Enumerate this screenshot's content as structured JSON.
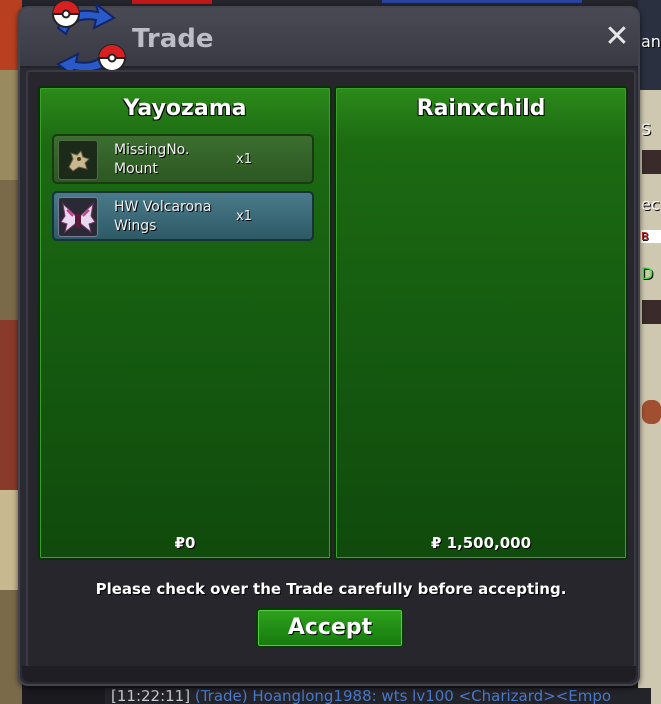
{
  "window": {
    "title": "Trade",
    "close_glyph": "✕"
  },
  "left_panel": {
    "player": "Yayozama",
    "money": "₽0",
    "items": [
      {
        "name": "MissingNo. Mount",
        "qty": "x1",
        "icon": "missingno-mount-icon"
      },
      {
        "name": "HW Volcarona Wings",
        "qty": "x1",
        "icon": "volcarona-wings-icon"
      }
    ]
  },
  "right_panel": {
    "player": "Rainxchild",
    "money": "₽ 1,500,000",
    "items": []
  },
  "notice": "Please check over the Trade carefully before accepting.",
  "accept_label": "Accept",
  "background": {
    "chat_time": "[11:22:11]",
    "chat_text": " (Trade) Hoanglong1988: wts lv100 <Charizard><Empo",
    "right_edge_texts": [
      "an",
      "S",
      "ec",
      "B",
      "D"
    ]
  },
  "colors": {
    "panel_green": "#1c6a12",
    "accept_green": "#2fa21c",
    "item_selected": "#2e5a66"
  }
}
